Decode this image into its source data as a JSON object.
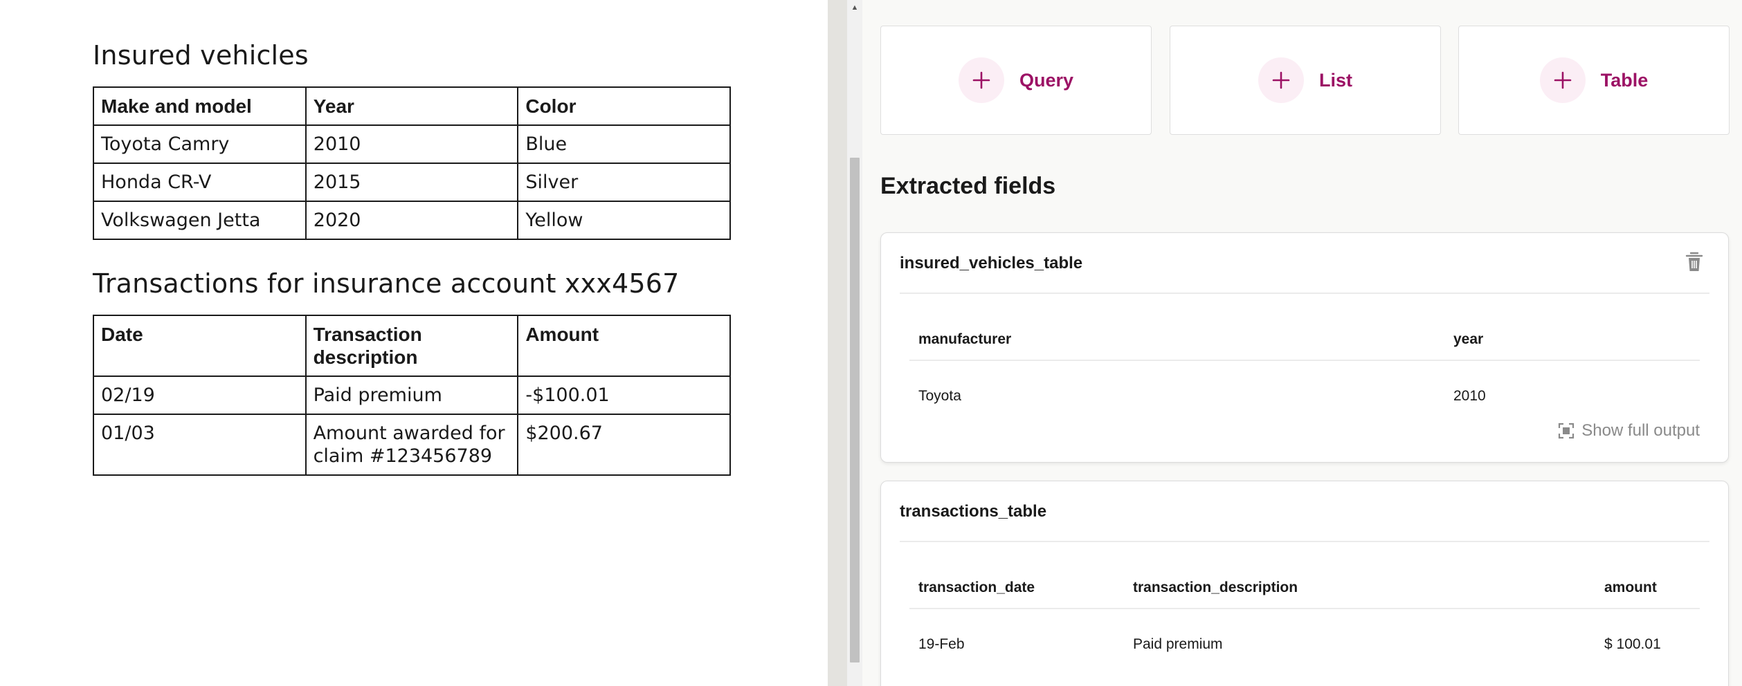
{
  "document": {
    "vehicles_heading": "Insured vehicles",
    "vehicles_table": {
      "headers": [
        "Make and model",
        "Year",
        "Color"
      ],
      "rows": [
        [
          "Toyota Camry",
          "2010",
          "Blue"
        ],
        [
          "Honda CR-V",
          "2015",
          "Silver"
        ],
        [
          "Volkswagen Jetta",
          "2020",
          "Yellow"
        ]
      ]
    },
    "transactions_heading": "Transactions for insurance account xxx4567",
    "transactions_table": {
      "headers": [
        "Date",
        "Transaction description",
        "Amount"
      ],
      "rows": [
        [
          "02/19",
          "Paid premium",
          "-$100.01"
        ],
        [
          "01/03",
          "Amount awarded for claim #123456789",
          "$200.67"
        ]
      ]
    }
  },
  "panel": {
    "add_buttons": [
      {
        "label": "Query",
        "icon": "plus-icon"
      },
      {
        "label": "List",
        "icon": "plus-icon"
      },
      {
        "label": "Table",
        "icon": "plus-icon"
      }
    ],
    "section_title": "Extracted fields",
    "cards": [
      {
        "name": "insured_vehicles_table",
        "columns": [
          "manufacturer",
          "year"
        ],
        "rows": [
          [
            "Toyota",
            "2010"
          ]
        ],
        "show_full_label": "Show full output"
      },
      {
        "name": "transactions_table",
        "columns": [
          "transaction_date",
          "transaction_description",
          "amount"
        ],
        "rows": [
          [
            "19-Feb",
            "Paid premium",
            "$ 100.01"
          ]
        ]
      }
    ],
    "accent_color": "#9c1265",
    "accent_bg": "#fbeef5"
  }
}
